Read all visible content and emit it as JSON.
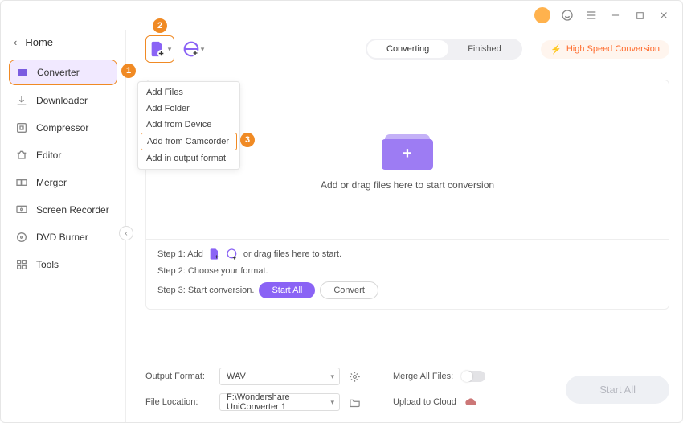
{
  "titlebar": {},
  "sidebar": {
    "home": "Home",
    "items": [
      {
        "label": "Converter"
      },
      {
        "label": "Downloader"
      },
      {
        "label": "Compressor"
      },
      {
        "label": "Editor"
      },
      {
        "label": "Merger"
      },
      {
        "label": "Screen Recorder"
      },
      {
        "label": "DVD Burner"
      },
      {
        "label": "Tools"
      }
    ]
  },
  "callouts": {
    "c1": "1",
    "c2": "2",
    "c3": "3"
  },
  "tabs": {
    "converting": "Converting",
    "finished": "Finished"
  },
  "hispeed": "High Speed Conversion",
  "dropdown": {
    "items": [
      {
        "label": "Add Files"
      },
      {
        "label": "Add Folder"
      },
      {
        "label": "Add from Device"
      },
      {
        "label": "Add from Camcorder"
      },
      {
        "label": "Add in output format"
      }
    ]
  },
  "drop": {
    "text": "Add or drag files here to start conversion"
  },
  "steps": {
    "s1a": "Step 1: Add",
    "s1b": "or drag files here to start.",
    "s2": "Step 2: Choose your format.",
    "s3": "Step 3: Start conversion.",
    "startall": "Start All",
    "convert": "Convert"
  },
  "bottom": {
    "output_label": "Output Format:",
    "output_value": "WAV",
    "location_label": "File Location:",
    "location_value": "F:\\Wondershare UniConverter 1",
    "merge_label": "Merge All Files:",
    "upload_label": "Upload to Cloud",
    "startall": "Start All"
  }
}
